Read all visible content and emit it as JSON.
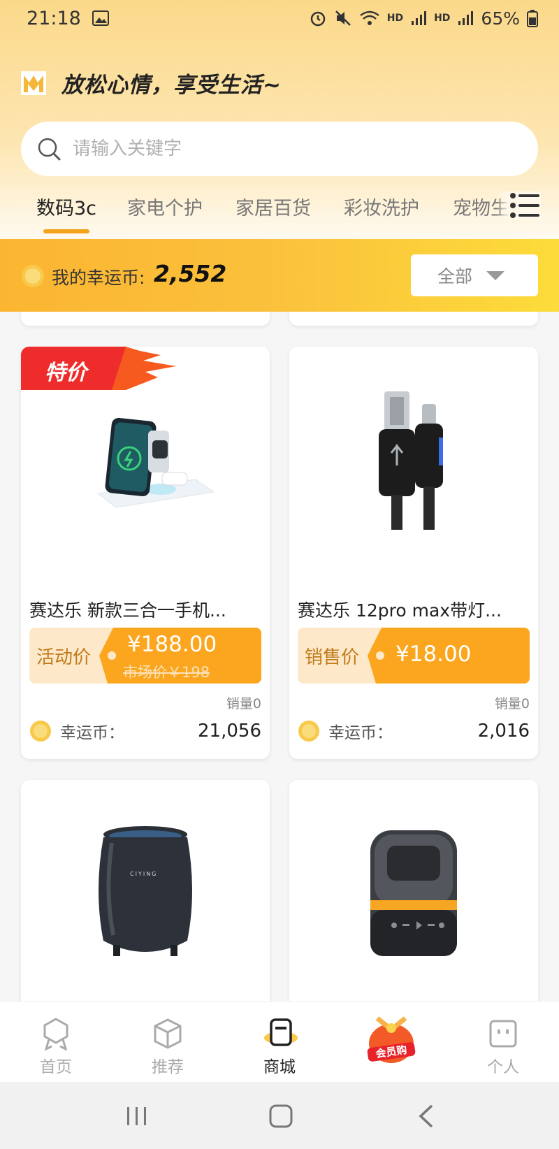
{
  "status_bar": {
    "time": "21:18",
    "net1": "HD",
    "net2": "HD",
    "battery": "65%"
  },
  "header": {
    "slogan": "放松心情，享受生活~"
  },
  "search": {
    "placeholder": "请输入关键字"
  },
  "tabs": [
    {
      "label": "数码3c",
      "active": true
    },
    {
      "label": "家电个护"
    },
    {
      "label": "家居百货"
    },
    {
      "label": "彩妆洗护"
    },
    {
      "label": "宠物生"
    }
  ],
  "coins": {
    "label": "我的幸运币:",
    "value": "2,552"
  },
  "filter": {
    "label": "全部"
  },
  "products": [
    {
      "badge": "特价",
      "name": "赛达乐 新款三合一手机...",
      "price_type": "活动价",
      "price": "¥188.00",
      "market_price": "市场价￥198",
      "sales": "销量0",
      "coin_label": "幸运币：",
      "coin_value": "21,056"
    },
    {
      "name": "赛达乐 12pro max带灯...",
      "price_type": "销售价",
      "price": "¥18.00",
      "sales": "销量0",
      "coin_label": "幸运币：",
      "coin_value": "2,016"
    },
    {
      "brand_text": "CIYING"
    },
    {}
  ],
  "bottom_nav": [
    {
      "label": "首页",
      "icon": "home-badge-icon"
    },
    {
      "label": "推荐",
      "icon": "box-icon"
    },
    {
      "label": "商城",
      "icon": "mall-icon",
      "active": true
    },
    {
      "label": "会员购",
      "icon": "gift-bag-icon"
    },
    {
      "label": "个人",
      "icon": "person-icon"
    }
  ],
  "colors": {
    "accent": "#f4a41c",
    "price_orange": "#fba61e",
    "coin_bar": "#fbc13c"
  }
}
